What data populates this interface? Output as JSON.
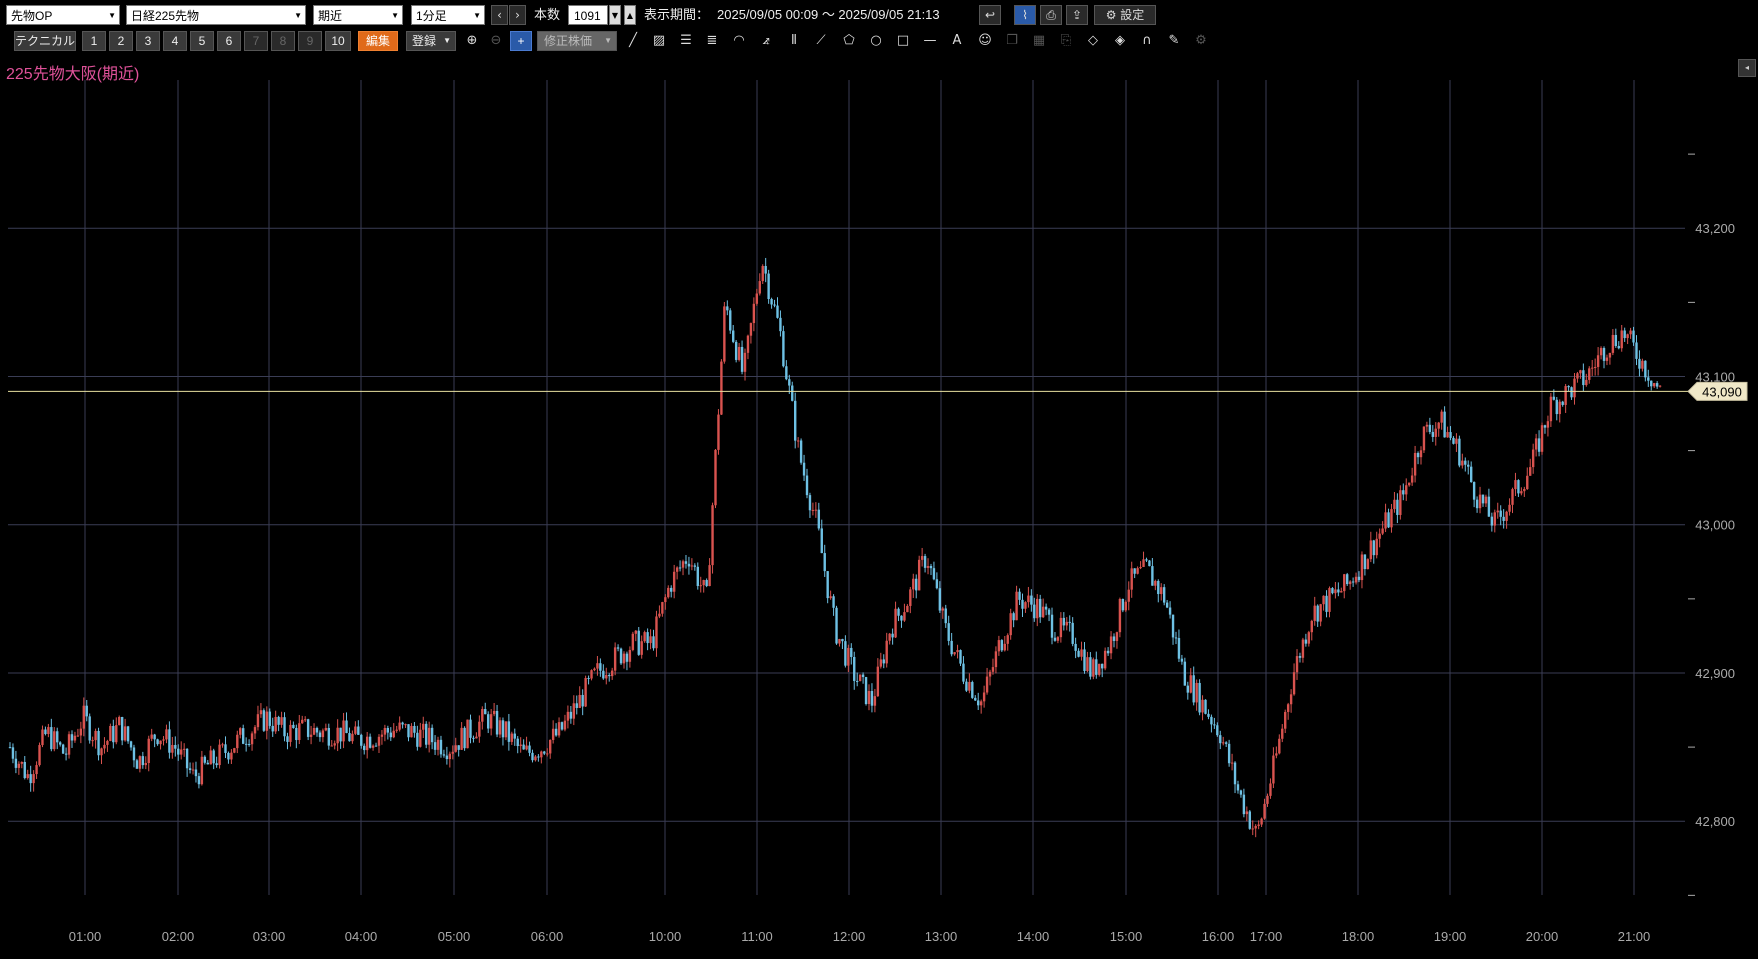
{
  "toolbar1": {
    "market_select": "先物OP",
    "symbol_select": "日経225先物",
    "month_select": "期近",
    "interval_select": "1分足",
    "prev_icon": "chevron-left-icon",
    "next_icon": "chevron-right-icon",
    "count_label": "本数",
    "count_value": "1091",
    "period_label": "表示期間：",
    "period_value": "2025/09/05 00:09 〜 2025/09/05 21:13",
    "settings_label": "設定"
  },
  "toolbar2": {
    "technical_label": "テクニカル",
    "preset_buttons": [
      "1",
      "2",
      "3",
      "4",
      "5",
      "6",
      "7",
      "8",
      "9",
      "10"
    ],
    "edit_label": "編集",
    "register_label": "登録",
    "adjusted_price_label": "修正株価"
  },
  "chart_title": "225先物大阪(期近)",
  "colors": {
    "background": "#000000",
    "grid": "#3a3d55",
    "up": "#d9534f",
    "down": "#6ec1e4",
    "price_line": "#e8e0a0",
    "title": "#e0529a",
    "axis_text": "#aaaaaa"
  },
  "chart_data": {
    "type": "candlestick",
    "title": "225先物大阪(期近)",
    "x_ticks": [
      "01:00",
      "02:00",
      "03:00",
      "04:00",
      "05:00",
      "06:00",
      "10:00",
      "11:00",
      "12:00",
      "13:00",
      "14:00",
      "15:00",
      "16:00",
      "17:00",
      "18:00",
      "19:00",
      "20:00",
      "21:00"
    ],
    "y_ticks": [
      "43,200",
      "43,100",
      "43,000",
      "42,900",
      "42,800"
    ],
    "y_tick_values": [
      43200,
      43100,
      43000,
      42900,
      42800
    ],
    "ylim": [
      42730,
      43300
    ],
    "current_price": 43090,
    "current_price_label": "43,090",
    "grid": true,
    "series_close": [
      [
        0,
        42850
      ],
      [
        0.5,
        42830
      ],
      [
        1,
        42860
      ],
      [
        1.5,
        42845
      ],
      [
        2,
        42870
      ],
      [
        2.5,
        42850
      ],
      [
        3,
        42865
      ],
      [
        3.5,
        42840
      ],
      [
        4,
        42860
      ],
      [
        4.5,
        42850
      ],
      [
        5,
        42830
      ],
      [
        5.5,
        42840
      ],
      [
        6,
        42850
      ],
      [
        6.5,
        42860
      ],
      [
        7,
        42870
      ],
      [
        7.5,
        42860
      ],
      [
        8,
        42862
      ],
      [
        8.5,
        42860
      ],
      [
        9,
        42860
      ],
      [
        9.5,
        42855
      ],
      [
        10,
        42858
      ],
      [
        10.5,
        42862
      ],
      [
        11,
        42860
      ],
      [
        11.5,
        42855
      ],
      [
        12,
        42850
      ],
      [
        12.5,
        42860
      ],
      [
        13,
        42870
      ],
      [
        13.5,
        42860
      ],
      [
        14,
        42845
      ],
      [
        14.5,
        42850
      ],
      [
        15,
        42860
      ],
      [
        15.5,
        42880
      ],
      [
        16,
        42900
      ],
      [
        16.5,
        42910
      ],
      [
        17,
        42920
      ],
      [
        17.5,
        42920
      ],
      [
        18,
        42960
      ],
      [
        18.5,
        42980
      ],
      [
        19,
        42950
      ],
      [
        19.5,
        43150
      ],
      [
        20,
        43100
      ],
      [
        20.5,
        43180
      ],
      [
        21,
        43130
      ],
      [
        21.5,
        43050
      ],
      [
        22,
        43000
      ],
      [
        22.5,
        42930
      ],
      [
        23,
        42900
      ],
      [
        23.5,
        42880
      ],
      [
        24,
        42930
      ],
      [
        24.5,
        42950
      ],
      [
        25,
        42980
      ],
      [
        25.5,
        42930
      ],
      [
        26,
        42900
      ],
      [
        26.5,
        42880
      ],
      [
        27,
        42920
      ],
      [
        27.5,
        42950
      ],
      [
        28,
        42945
      ],
      [
        28.5,
        42930
      ],
      [
        29,
        42925
      ],
      [
        29.5,
        42900
      ],
      [
        30,
        42920
      ],
      [
        30.5,
        42960
      ],
      [
        31,
        42970
      ],
      [
        31.5,
        42950
      ],
      [
        32,
        42900
      ],
      [
        32.5,
        42880
      ],
      [
        33,
        42860
      ],
      [
        33.5,
        42820
      ],
      [
        34,
        42790
      ],
      [
        34.5,
        42840
      ],
      [
        35,
        42900
      ],
      [
        35.5,
        42940
      ],
      [
        36,
        42950
      ],
      [
        36.5,
        42960
      ],
      [
        37,
        42980
      ],
      [
        37.5,
        43000
      ],
      [
        38,
        43020
      ],
      [
        38.5,
        43060
      ],
      [
        39,
        43070
      ],
      [
        39.5,
        43050
      ],
      [
        40,
        43020
      ],
      [
        40.5,
        43000
      ],
      [
        41,
        43020
      ],
      [
        41.5,
        43040
      ],
      [
        42,
        43080
      ],
      [
        42.5,
        43090
      ],
      [
        43,
        43100
      ],
      [
        43.5,
        43120
      ],
      [
        44,
        43130
      ],
      [
        44.5,
        43110
      ],
      [
        45,
        43090
      ]
    ]
  }
}
